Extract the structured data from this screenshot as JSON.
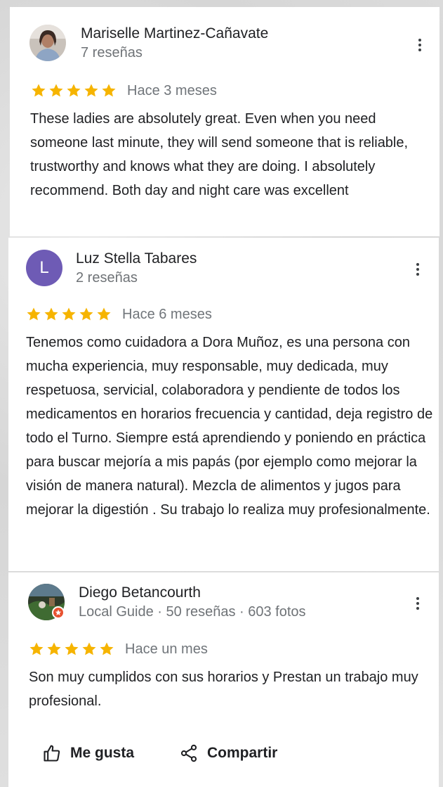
{
  "colors": {
    "star": "#f6b400",
    "avatar_letter_bg": "#6e5bb5",
    "local_guide_badge": "#e8512f"
  },
  "reviews": [
    {
      "author": "Mariselle Martinez-Cañavate",
      "meta": "7 reseñas",
      "stars": 5,
      "date": "Hace 3 meses",
      "text": "These ladies are absolutely great. Even when you need someone last minute, they will send someone that is reliable, trustworthy and knows what they are doing. I absolutely recommend. Both day and night care was excellent",
      "avatar": "photo-avatar"
    },
    {
      "author": "Luz Stella Tabares",
      "meta": "2 reseñas",
      "stars": 5,
      "date": "Hace 6 meses",
      "text": "Tenemos como cuidadora a Dora Muñoz, es una persona con mucha experiencia, muy responsable, muy dedicada, muy respetuosa, servicial, colaboradora y pendiente de todos los medicamentos en horarios frecuencia y cantidad, deja registro de todo el Turno. Siempre está aprendiendo y poniendo en práctica para buscar mejoría a mis papás (por ejemplo como mejorar la visión de manera natural). Mezcla de alimentos y jugos para mejorar la digestión . Su trabajo lo realiza muy profesionalmente.",
      "avatar_letter": "L"
    },
    {
      "author": "Diego Betancourth",
      "meta": "Local Guide · 50 reseñas · 603 fotos",
      "stars": 5,
      "date": "Hace un mes",
      "text": "Son muy cumplidos con sus horarios y Prestan un trabajo muy profesional.",
      "avatar": "photo-avatar"
    }
  ],
  "actions": {
    "like_label": "Me gusta",
    "share_label": "Compartir"
  }
}
